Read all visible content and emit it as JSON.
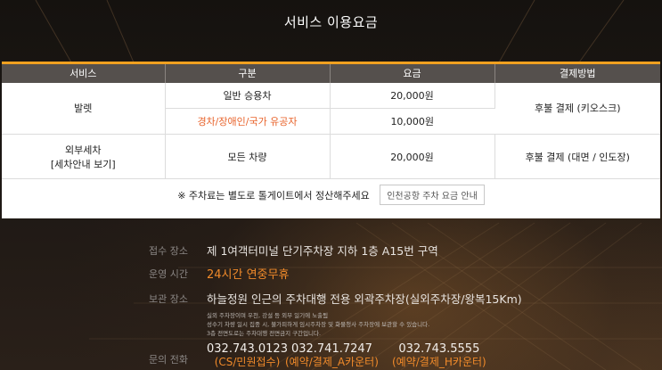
{
  "title": "서비스 이용요금",
  "table": {
    "headers": [
      "서비스",
      "구분",
      "요금",
      "결제방법"
    ],
    "valet": {
      "service": "발렛",
      "rows": [
        {
          "type": "일반 승용차",
          "fee": "20,000원"
        },
        {
          "type": "경차/장애인/국가 유공자",
          "fee": "10,000원"
        }
      ],
      "payment": "후불 결제 (키오스크)"
    },
    "wash": {
      "service": "외부세차",
      "link": "[세차안내 보기]",
      "type": "모든 차량",
      "fee": "20,000원",
      "payment": "후불 결제 (대면 / 인도장)"
    },
    "note": {
      "prefix": "※ 주차료는 ",
      "highlight": "별도",
      "suffix": "로 톨게이트에서 정산해주세요",
      "button": "인천공항 주차 요금 안내"
    }
  },
  "info": {
    "reception": {
      "label": "접수 장소",
      "value": "제 1여객터미널 단기주차장 지하 1층 A15번 구역"
    },
    "hours": {
      "label": "운영 시간",
      "value": "24시간 연중무휴"
    },
    "storage": {
      "label": "보관 장소",
      "value": "하늘정원 인근의 주차대행 전용 외곽주차장(실외주차장/왕복15Km)"
    },
    "storage_notes": [
      "실외 주차장이며 우천, 강설 등 외부 일기에 노출됨",
      "성수기 차량 일시 집중 시, 불가피하게 임시주차장 및 화물청사 주차장에 보관할 수 있습니다.",
      "3층 전면도로는 주차대행 전면금지 구간입니다."
    ],
    "contact": {
      "label": "문의 전화",
      "numbers": [
        {
          "number": "032.743.0123",
          "desc": "(CS/민원접수)"
        },
        {
          "number": "032.741.7247",
          "desc": "(예약/결제_A카운터)"
        },
        {
          "number": "032.743.5555",
          "desc": "(예약/결제_H카운터)"
        }
      ]
    }
  },
  "colors": {
    "accent": "#f0a020",
    "orange_text": "#e8632b",
    "header_bg": "#55504d"
  }
}
